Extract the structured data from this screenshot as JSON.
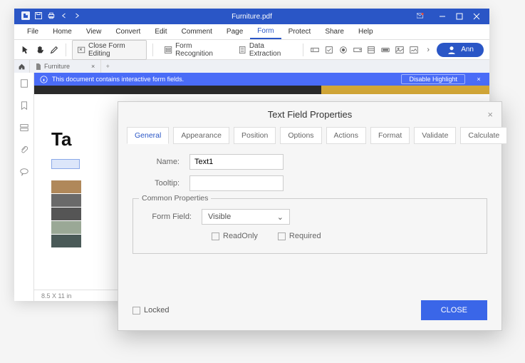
{
  "titlebar": {
    "filename": "Furniture.pdf"
  },
  "menubar": [
    "File",
    "Home",
    "View",
    "Convert",
    "Edit",
    "Comment",
    "Page",
    "Form",
    "Protect",
    "Share",
    "Help"
  ],
  "menubar_active_index": 7,
  "toolbar": {
    "close_form_editing": "Close Form Editing",
    "form_recognition": "Form Recognition",
    "data_extraction": "Data Extraction",
    "user": "Ann"
  },
  "doc_tab": {
    "name": "Furniture",
    "close": "×",
    "add": "+"
  },
  "banner": {
    "text": "This document contains interactive form fields.",
    "button": "Disable Highlight",
    "close": "×"
  },
  "page": {
    "heading_fragment": "Ta"
  },
  "statusbar": {
    "dims": "8.5 X 11 in"
  },
  "dialog": {
    "title": "Text Field Properties",
    "close": "×",
    "tabs": [
      "General",
      "Appearance",
      "Position",
      "Options",
      "Actions",
      "Format",
      "Validate",
      "Calculate"
    ],
    "active_tab_index": 0,
    "name_label": "Name:",
    "name_value": "Text1",
    "tooltip_label": "Tooltip:",
    "tooltip_value": "",
    "common_legend": "Common Properties",
    "form_field_label": "Form Field:",
    "form_field_value": "Visible",
    "readonly_label": "ReadOnly",
    "required_label": "Required",
    "locked_label": "Locked",
    "close_btn": "CLOSE"
  }
}
